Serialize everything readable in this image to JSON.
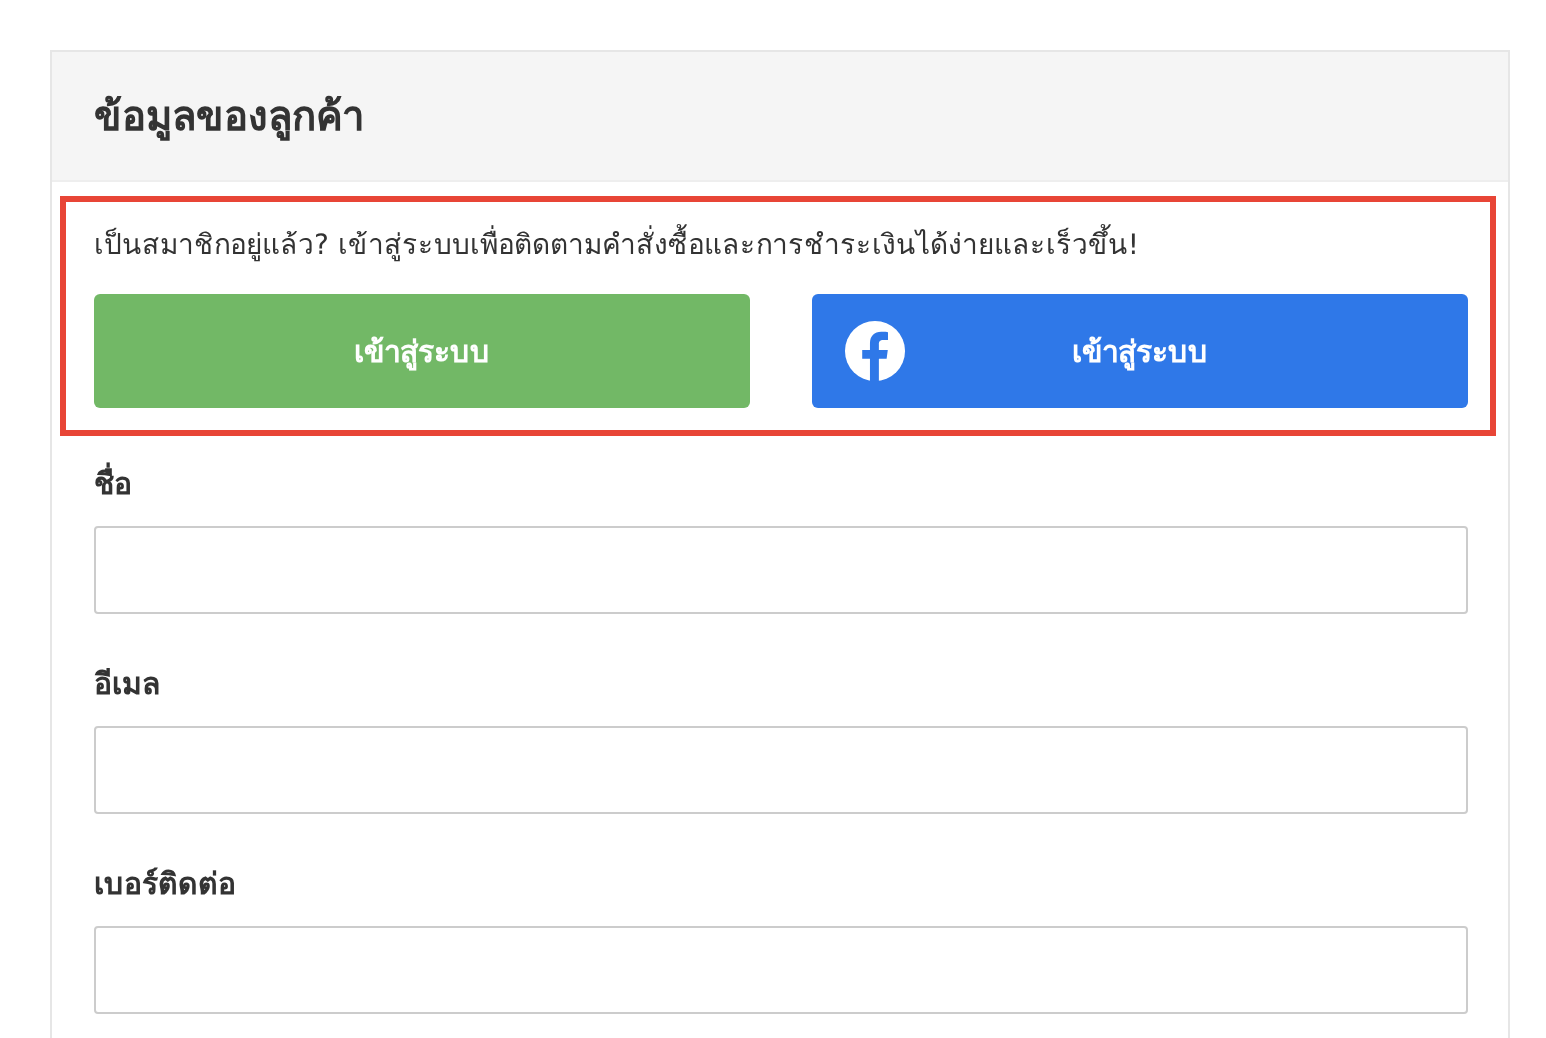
{
  "section": {
    "title": "ข้อมูลของลูกค้า"
  },
  "login_prompt": {
    "message": "เป็นสมาชิกอยู่แล้ว? เข้าสู่ระบบเพื่อติดตามคำสั่งซื้อและการชำระเงินได้ง่ายและเร็วขึ้น!",
    "buttons": [
      {
        "kind": "plain",
        "label": "เข้าสู่ระบบ"
      },
      {
        "kind": "facebook",
        "label": "เข้าสู่ระบบ"
      }
    ]
  },
  "fields": [
    {
      "label": "ชื่อ"
    },
    {
      "label": "อีเมล"
    },
    {
      "label": "เบอร์ติดต่อ"
    }
  ]
}
